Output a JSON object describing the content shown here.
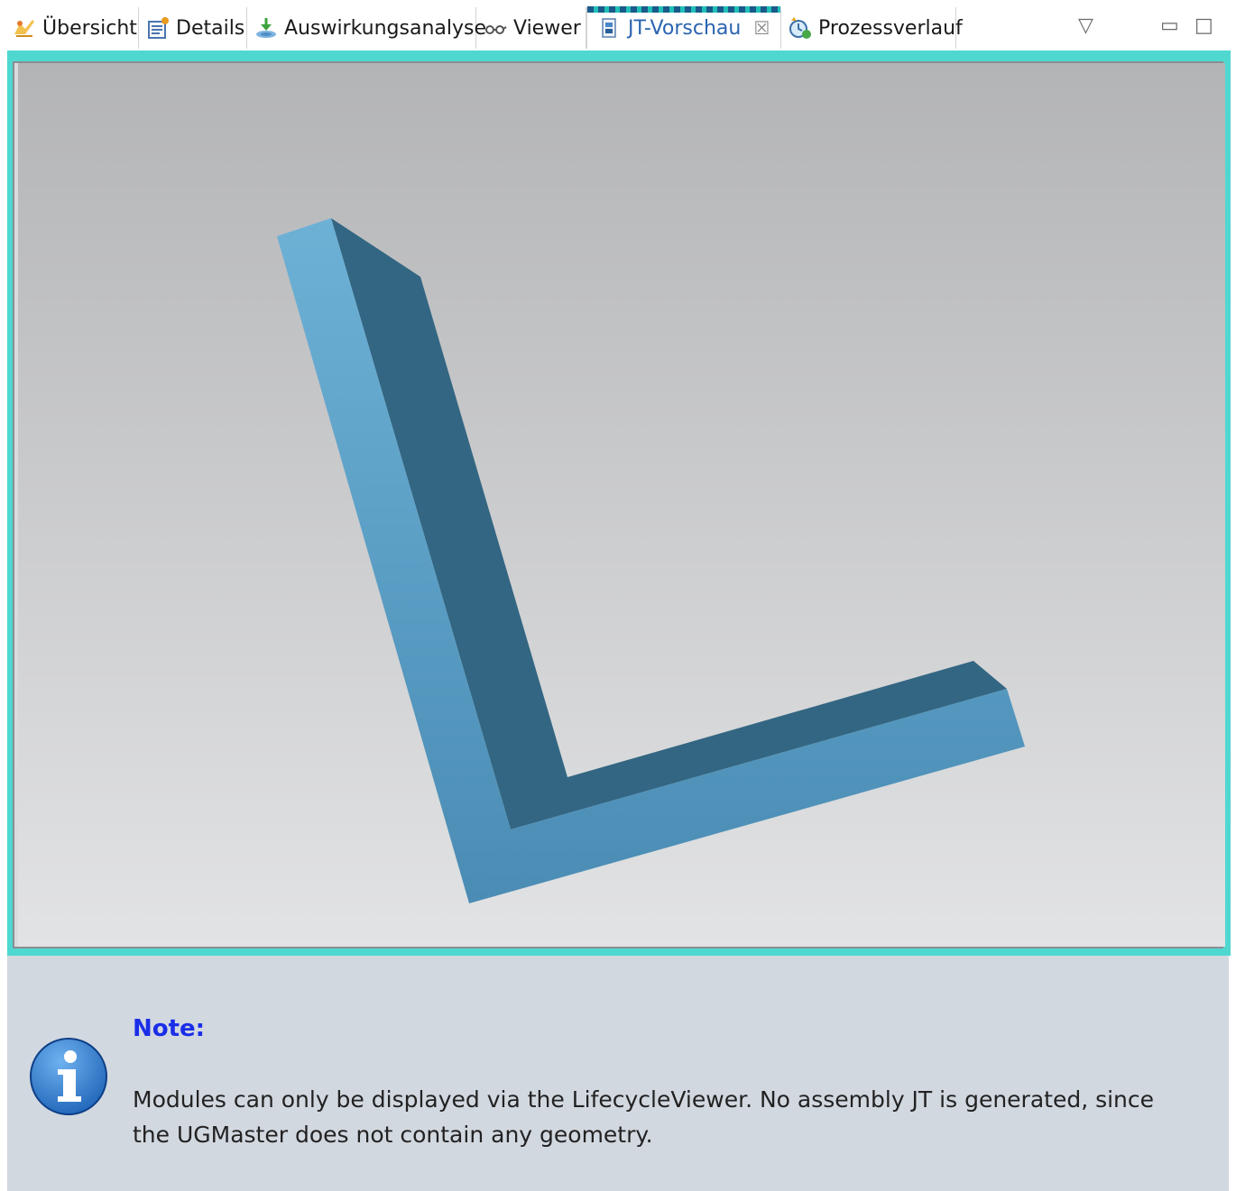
{
  "tabs": [
    {
      "label": "Übersicht",
      "icon": "overview-icon",
      "active": false
    },
    {
      "label": "Details",
      "icon": "details-icon",
      "active": false
    },
    {
      "label": "Auswirkungsanalyse",
      "icon": "impact-analysis-icon",
      "active": false
    },
    {
      "label": "Viewer",
      "icon": "glasses-icon",
      "active": false
    },
    {
      "label": "JT-Vorschau",
      "icon": "jt-preview-icon",
      "active": true
    },
    {
      "label": "Prozessverlauf",
      "icon": "process-history-icon",
      "active": false
    }
  ],
  "window_controls": {
    "menu": "▽",
    "minimize": "▭",
    "maximize": "□"
  },
  "tab_close_glyph": "☒",
  "colors": {
    "part_face_light": "#5da3c9",
    "part_face_dark": "#336682",
    "viewport_top": "#b3b4b6",
    "viewport_bottom": "#e2e3e5",
    "focus_border": "#4fd8d0",
    "note_background": "#d2d8e0",
    "note_title": "#1a2ee8"
  },
  "note": {
    "title": "Note:",
    "text": "Modules can only be displayed via the LifecycleViewer. No assembly JT is generated, since the UGMaster does not contain any geometry.",
    "icon": "info-icon"
  }
}
